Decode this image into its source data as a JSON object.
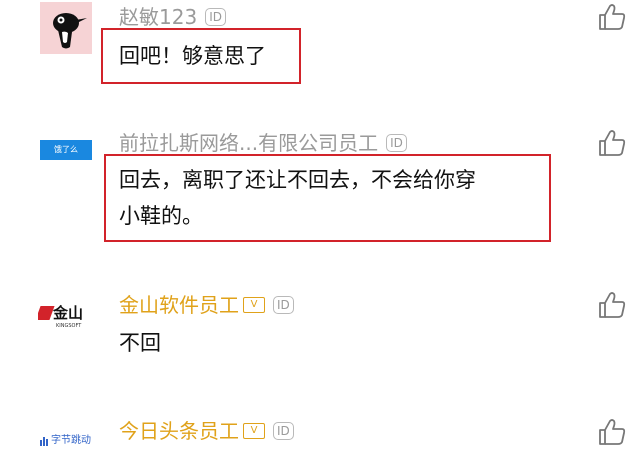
{
  "comments": [
    {
      "user": "赵敏123",
      "badge": "ID",
      "text_lines": [
        "回吧！够意思了"
      ],
      "avatar_icon": "woodpecker-logo-icon"
    },
    {
      "user": "前拉扎斯网络...有限公司员工",
      "badge": "ID",
      "text_lines": [
        "回去，离职了还让不回去，不会给你穿",
        "小鞋的。"
      ],
      "avatar_label": "饿了么",
      "avatar_icon": "eleme-logo-icon"
    },
    {
      "user": "金山软件员工",
      "badge": "ID",
      "vip_label": "V",
      "text_lines": [
        "不回"
      ],
      "avatar_logo": "金山",
      "avatar_sub": "KINGSOFT",
      "avatar_icon": "kingsoft-logo-icon"
    },
    {
      "user": "今日头条员工",
      "badge": "ID",
      "vip_label": "V",
      "text_lines": [],
      "avatar_logo": "字节跳动",
      "avatar_icon": "bytedance-logo-icon"
    }
  ],
  "colors": {
    "highlight": "#d2232a",
    "vip_name": "#e0a21a",
    "name": "#9a9a9a"
  },
  "icons": {
    "like": "thumbs-up-icon"
  }
}
